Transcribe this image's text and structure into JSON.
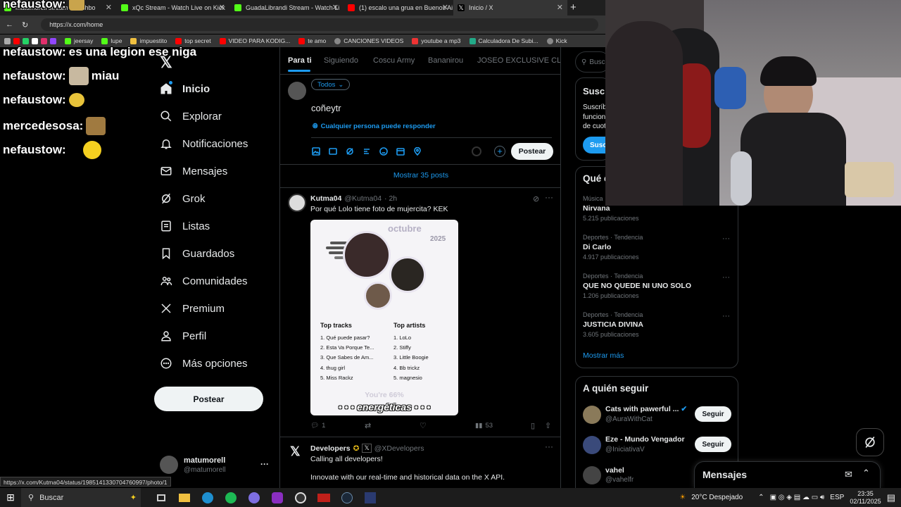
{
  "tabs": [
    {
      "label": "matumorell stream - Dashbo",
      "color": "#53fc18"
    },
    {
      "label": "xQc Stream - Watch Live on Kick",
      "color": "#53fc18"
    },
    {
      "label": "GuadaLibrandi Stream - Watch Li",
      "color": "#53fc18"
    },
    {
      "label": "(1) escalo una grua en Buenos Ai",
      "color": "#ff0000"
    },
    {
      "label": "Inicio / X",
      "color": "#ffffff"
    }
  ],
  "url": "https://x.com/home",
  "bookmarks": [
    "jeersay",
    "lupe",
    "impuestito",
    "top secret",
    "VIDEO PARA KODIG...",
    "te amo",
    "CANCIONES VIDEOS",
    "youtube a mp3",
    "Calculadora De Subi...",
    "Kick"
  ],
  "chat": [
    {
      "user": "nefaustow:",
      "msg": ""
    },
    {
      "user": "nefaustow:",
      "msg": "es una legion ese niga"
    },
    {
      "user": "nefaustow:",
      "msg": "miau"
    },
    {
      "user": "nefaustow:",
      "msg": ""
    },
    {
      "user": "mercedesosa:",
      "msg": ""
    },
    {
      "user": "nefaustow:",
      "msg": ""
    }
  ],
  "nav": [
    {
      "label": "Inicio",
      "icon": "home-icon"
    },
    {
      "label": "Explorar",
      "icon": "search-icon"
    },
    {
      "label": "Notificaciones",
      "icon": "bell-icon"
    },
    {
      "label": "Mensajes",
      "icon": "mail-icon"
    },
    {
      "label": "Grok",
      "icon": "grok-icon"
    },
    {
      "label": "Listas",
      "icon": "list-icon"
    },
    {
      "label": "Guardados",
      "icon": "bookmark-icon"
    },
    {
      "label": "Comunidades",
      "icon": "people-icon"
    },
    {
      "label": "Premium",
      "icon": "x-icon"
    },
    {
      "label": "Perfil",
      "icon": "person-icon"
    },
    {
      "label": "Más opciones",
      "icon": "more-icon"
    }
  ],
  "post_button": "Postear",
  "account": {
    "name": "matumorell",
    "handle": "@matumorell"
  },
  "status_url": "https://x.com/Kutma04/status/1985141330704760997/photo/1",
  "feed_tabs": [
    "Para ti",
    "Siguiendo",
    "Coscu Army",
    "Bananirou",
    "JOSEO EXCLUSIVE CLUB"
  ],
  "composer": {
    "audience": "Todos",
    "text": "coñeytr",
    "reply_setting": "Cualquier persona puede responder",
    "submit": "Postear"
  },
  "show_posts": "Mostrar 35 posts",
  "post1": {
    "name": "Kutma04",
    "handle": "@Kutma04",
    "time": "· 2h",
    "text": "Por qué Lolo tiene foto de mujercita? KEK",
    "card": {
      "month": "octubre",
      "year": "2025",
      "tracks_title": "Top tracks",
      "tracks": [
        "1. Qué puede pasar?",
        "2. Esta Va Porque Te...",
        "3. Que Sabes de Am...",
        "4. thug girl",
        "5. Miss Rackz"
      ],
      "artists_title": "Top artists",
      "artists": [
        "1. LoLo",
        "2. Stiffy",
        "3. Little Boogie",
        "4. Bb trickz",
        "5. magnesio"
      ],
      "footer": "You're 66%",
      "footer_word": "energéticas"
    },
    "replies": "1",
    "views": "53"
  },
  "post2": {
    "name": "Developers",
    "handle": "@XDevelopers",
    "text": "Calling all developers!",
    "text2": "Innovate with our real-time and historical data on the X API."
  },
  "search_placeholder": "Buscar",
  "premium": {
    "title": "Suscríbete a Premium",
    "text1": "Suscríbete para desbloquear nuevas",
    "text2": "funciones y, si eres elegible, recibe",
    "text3": "de cuota de ingresos.",
    "button": "Suscribirse"
  },
  "trends_title": "Qué está pasando",
  "trends": [
    {
      "cat": "Música · Tendencia",
      "name": "Nirvana",
      "count": "5.215 publicaciones"
    },
    {
      "cat": "Deportes · Tendencia",
      "name": "Di Carlo",
      "count": "4.917 publicaciones"
    },
    {
      "cat": "Deportes · Tendencia",
      "name": "QUE NO QUEDE NI UNO SOLO",
      "count": "1.206 publicaciones"
    },
    {
      "cat": "Deportes · Tendencia",
      "name": "JUSTICIA DIVINA",
      "count": "3.605 publicaciones"
    }
  ],
  "show_more": "Mostrar más",
  "who_to_follow": {
    "title": "A quién seguir",
    "button": "Seguir",
    "items": [
      {
        "name": "Cats with pawerful ...",
        "handle": "@AuraWithCat"
      },
      {
        "name": "Eze - Mundo Vengador",
        "handle": "@IniciativaV"
      },
      {
        "name": "vahel",
        "handle": "@vahelfr"
      }
    ]
  },
  "messages_drawer": "Mensajes",
  "taskbar": {
    "search": "Buscar",
    "weather": "20°C  Despejado",
    "lang": "ESP",
    "time": "23:35",
    "date": "02/11/2025"
  },
  "colors": {
    "accent": "#1d9bf0",
    "bg": "#000000",
    "border": "#2f3336",
    "muted": "#71767b"
  }
}
